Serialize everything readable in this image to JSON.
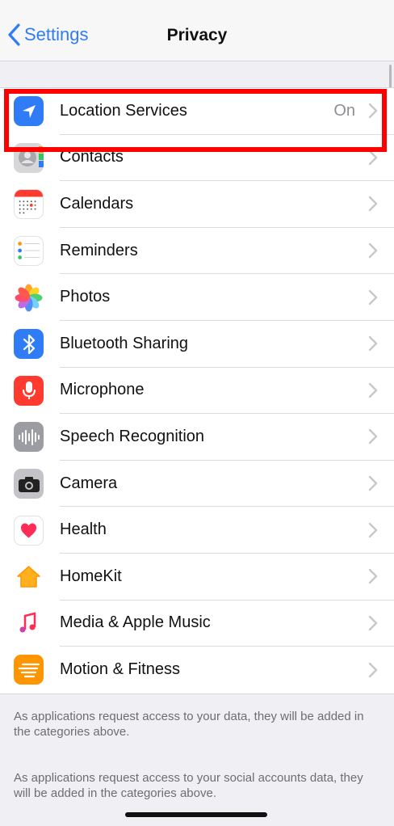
{
  "nav": {
    "back_label": "Settings",
    "title": "Privacy"
  },
  "rows": [
    {
      "label": "Location Services",
      "value": "On",
      "icon": "location-arrow-icon",
      "color": "#2f7cf6"
    },
    {
      "label": "Contacts",
      "icon": "contacts-icon",
      "color": "#9e9e9e"
    },
    {
      "label": "Calendars",
      "icon": "calendar-icon",
      "color": "#ff3b30"
    },
    {
      "label": "Reminders",
      "icon": "reminders-icon",
      "color": "#ffffff"
    },
    {
      "label": "Photos",
      "icon": "photos-icon",
      "color": "#ffffff"
    },
    {
      "label": "Bluetooth Sharing",
      "icon": "bluetooth-icon",
      "color": "#2f7cf6"
    },
    {
      "label": "Microphone",
      "icon": "microphone-icon",
      "color": "#ff3b30"
    },
    {
      "label": "Speech Recognition",
      "icon": "waveform-icon",
      "color": "#8e8e93"
    },
    {
      "label": "Camera",
      "icon": "camera-icon",
      "color": "#8e8e93"
    },
    {
      "label": "Health",
      "icon": "heart-icon",
      "color": "#ff2d55"
    },
    {
      "label": "HomeKit",
      "icon": "home-icon",
      "color": "#ff9500"
    },
    {
      "label": "Media & Apple Music",
      "icon": "music-note-icon",
      "color": "#ff2d55"
    },
    {
      "label": "Motion & Fitness",
      "icon": "motion-icon",
      "color": "#ff9500"
    }
  ],
  "notes": [
    "As applications request access to your data, they will be added in the categories above.",
    "As applications request access to your social accounts data, they will be added in the categories above."
  ]
}
